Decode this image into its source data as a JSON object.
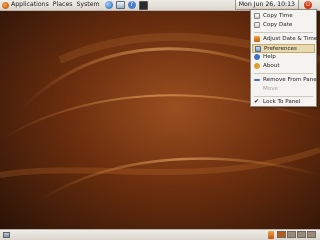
{
  "top_panel": {
    "menus": [
      "Applications",
      "Places",
      "System"
    ],
    "clock": "Mon Jun 26, 10:13"
  },
  "clock_menu": {
    "items": [
      {
        "label": "Copy Time",
        "icon": "copy-icon",
        "state": "normal"
      },
      {
        "label": "Copy Date",
        "icon": "copy-icon",
        "state": "normal"
      },
      {
        "label": "Adjust Date & Time",
        "icon": "adjust-time-icon",
        "state": "normal"
      },
      {
        "label": "Preferences",
        "icon": "preferences-icon",
        "state": "highlighted"
      },
      {
        "label": "Help",
        "icon": "help-icon",
        "state": "normal"
      },
      {
        "label": "About",
        "icon": "about-icon",
        "state": "normal"
      },
      {
        "label": "Remove From Panel",
        "icon": "remove-icon",
        "state": "normal"
      },
      {
        "label": "Move",
        "icon": "",
        "state": "disabled"
      },
      {
        "label": "Lock To Panel",
        "icon": "checkmark-icon",
        "state": "checked"
      }
    ]
  },
  "colors": {
    "wallpaper_dark": "#2a1206",
    "wallpaper_warm": "#8a4318",
    "panel": "#e6e1db",
    "highlight": "#e8d9b0",
    "workspace_active": "#b45a1c",
    "workspace_inactive": "#9a8a7a"
  }
}
